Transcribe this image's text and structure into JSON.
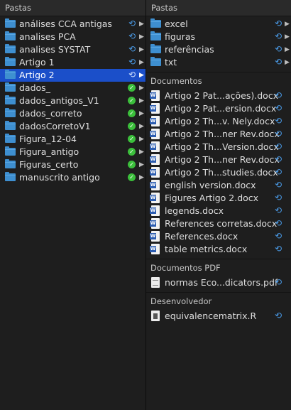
{
  "left": {
    "header": "Pastas",
    "items": [
      {
        "label": "análises CCA antigas",
        "status": "sync"
      },
      {
        "label": "analises PCA",
        "status": "sync"
      },
      {
        "label": "analises SYSTAT",
        "status": "sync"
      },
      {
        "label": "Artigo 1",
        "status": "sync"
      },
      {
        "label": "Artigo 2",
        "status": "sync",
        "selected": true
      },
      {
        "label": "dados_",
        "status": "check"
      },
      {
        "label": "dados_antigos_V1",
        "status": "check"
      },
      {
        "label": "dados_correto",
        "status": "check"
      },
      {
        "label": "dadosCorretoV1",
        "status": "check"
      },
      {
        "label": "Figura_12-04",
        "status": "check"
      },
      {
        "label": "Figura_antigo",
        "status": "check"
      },
      {
        "label": "Figuras_certo",
        "status": "check"
      },
      {
        "label": "manuscrito antigo",
        "status": "check"
      }
    ]
  },
  "right": {
    "header": "Pastas",
    "folders": [
      {
        "label": "excel"
      },
      {
        "label": "figuras"
      },
      {
        "label": "referências"
      },
      {
        "label": "txt"
      }
    ],
    "documents_header": "Documentos",
    "documents": [
      {
        "label": "Artigo 2 Pat...ações).docx"
      },
      {
        "label": "Artigo 2 Pat...ersion.docx"
      },
      {
        "label": "Artigo 2 Th...v. Nely.docx"
      },
      {
        "label": "Artigo 2 Th...ner Rev.docx"
      },
      {
        "label": "Artigo 2 Th...Version.docx"
      },
      {
        "label": "Artigo 2 Th...ner Rev.docx"
      },
      {
        "label": "Artigo 2 Th...studies.docx"
      },
      {
        "label": "english version.docx"
      },
      {
        "label": "Figures Artigo 2.docx"
      },
      {
        "label": "legends.docx"
      },
      {
        "label": "References corretas.docx"
      },
      {
        "label": "References.docx"
      },
      {
        "label": "table metrics.docx"
      }
    ],
    "pdf_header": "Documentos PDF",
    "pdfs": [
      {
        "label": "normas Eco...dicators.pdf"
      }
    ],
    "dev_header": "Desenvolvedor",
    "dev_files": [
      {
        "label": "equivalencematrix.R"
      }
    ]
  },
  "colors": {
    "background": "#1e1e1e",
    "selection": "#1b4fc9",
    "folder": "#3e8fd0",
    "sync": "#4a9be8",
    "check": "#3bbf3b"
  },
  "icons": {
    "sync": "sync-icon",
    "check": "check-icon",
    "chevron": "chevron-right-icon",
    "folder": "folder-icon",
    "word": "word-doc-icon",
    "pdf": "pdf-icon",
    "r": "r-file-icon"
  }
}
